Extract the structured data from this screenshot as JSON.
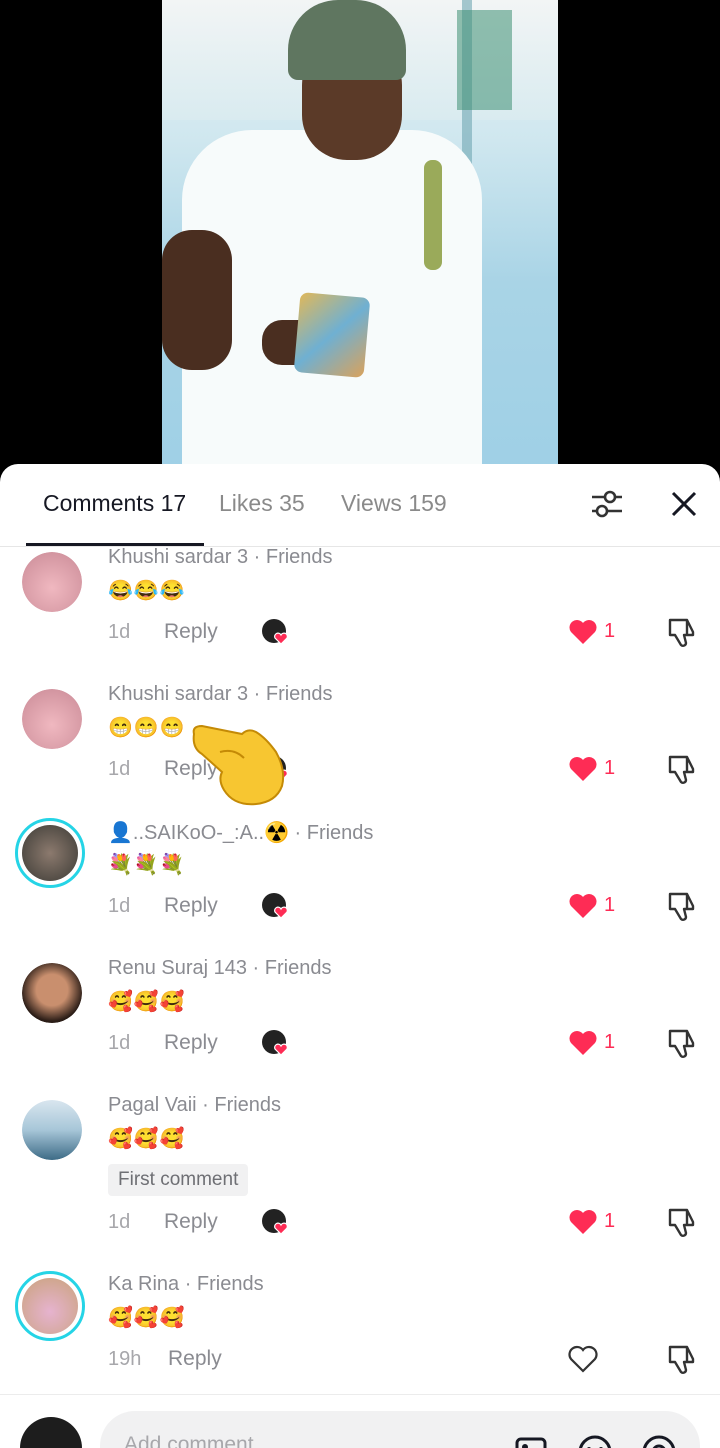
{
  "tabs": {
    "comments": "Comments 17",
    "likes": "Likes 35",
    "views": "Views 159"
  },
  "icons": {
    "filter": "filter-sliders-icon",
    "close": "close-icon",
    "heart": "heart-icon",
    "dislike": "thumbs-down-icon",
    "image": "image-icon",
    "emoji": "emoji-icon",
    "mention": "at-mention-icon"
  },
  "colors": {
    "accent": "#fe2c55",
    "ring": "#25d4e6",
    "text_primary": "#161823",
    "text_secondary": "#8a8b91"
  },
  "comments": [
    {
      "name": "Khushi sardar 3 · Friends",
      "emoji": "😂😂😂",
      "time": "1d",
      "reply": "Reply",
      "likes": "1",
      "liked": true
    },
    {
      "name": "Khushi sardar 3 · Friends",
      "emoji": "😁😁😁",
      "time": "1d",
      "reply": "Reply",
      "likes": "1",
      "liked": true
    },
    {
      "name": "👤..SAIKoO-_:A..☢️ · Friends",
      "emoji": "💐💐💐",
      "time": "1d",
      "reply": "Reply",
      "likes": "1",
      "liked": true
    },
    {
      "name": "Renu Suraj 143 · Friends",
      "emoji": "🥰🥰🥰",
      "time": "1d",
      "reply": "Reply",
      "likes": "1",
      "liked": true
    },
    {
      "name": "Pagal Vaii · Friends",
      "emoji": "🥰🥰🥰",
      "badge": "First comment",
      "time": "1d",
      "reply": "Reply",
      "likes": "1",
      "liked": true
    },
    {
      "name": "Ka Rina · Friends",
      "emoji": "🥰🥰🥰",
      "time": "19h",
      "reply": "Reply",
      "likes": "",
      "liked": false
    }
  ],
  "composer": {
    "placeholder": "Add comment..."
  }
}
